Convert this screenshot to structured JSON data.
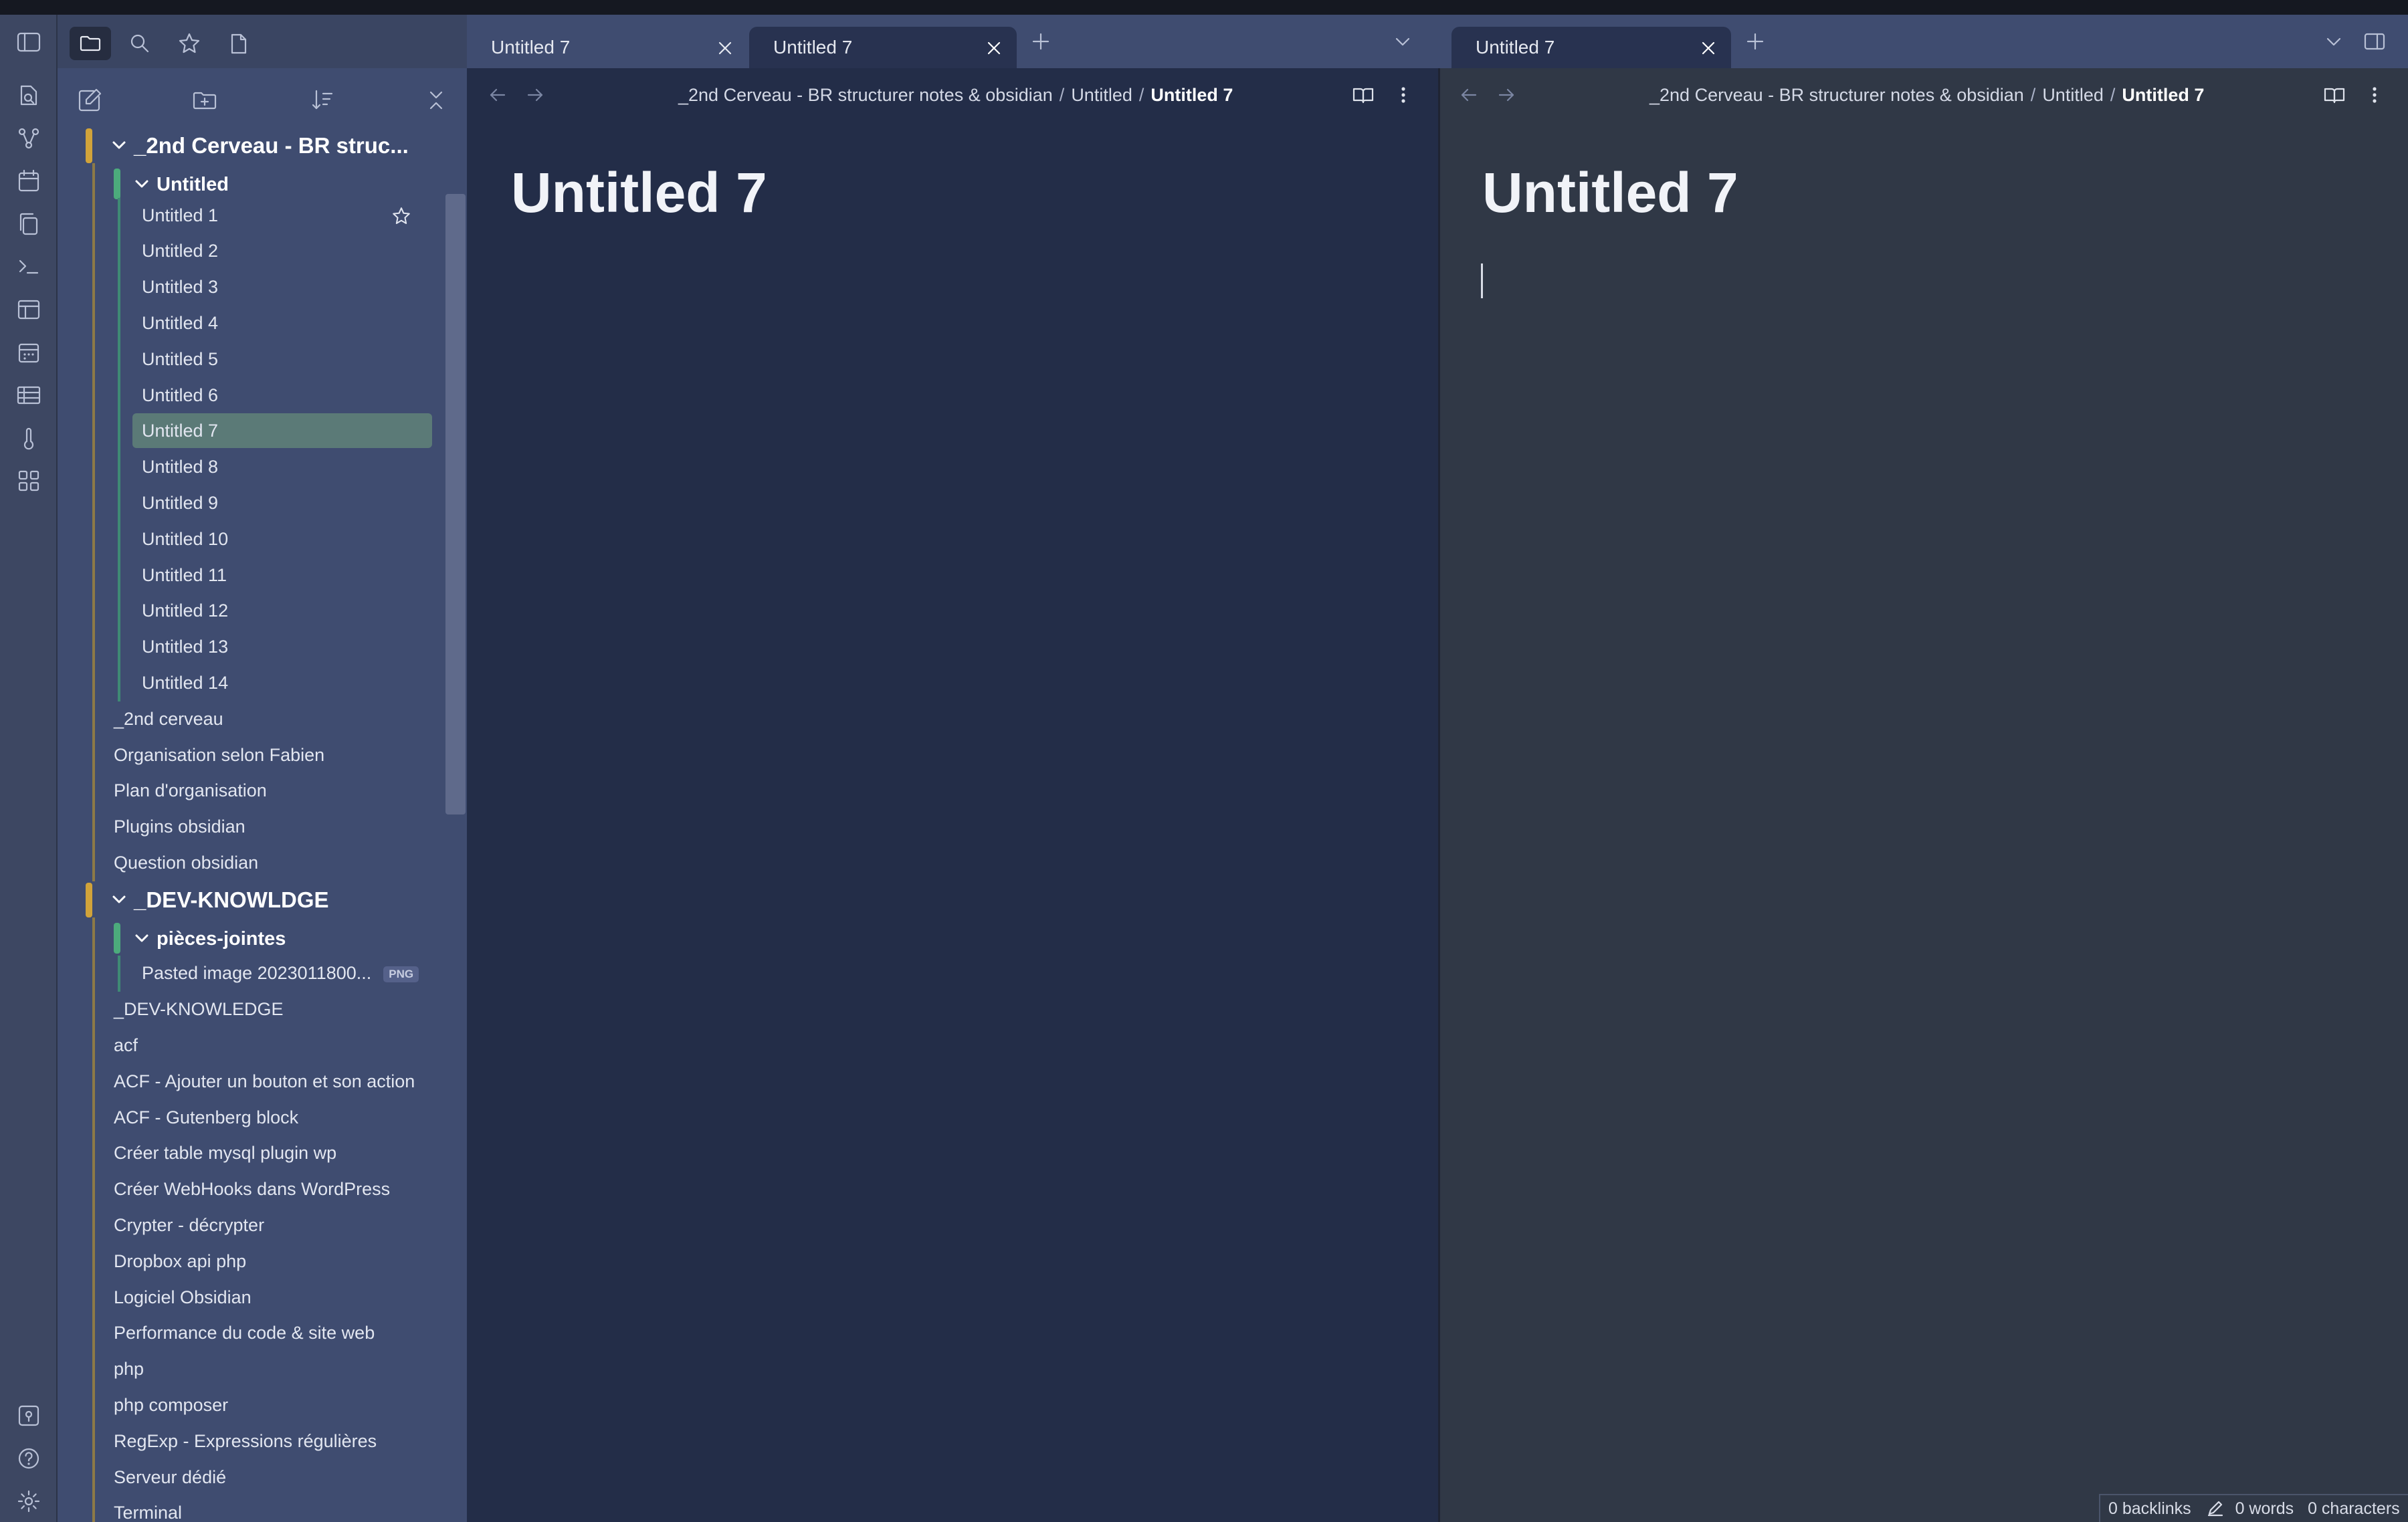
{
  "ribbon": {
    "icons": [
      "sidebar-toggle-icon",
      "file-search-icon",
      "graph-icon",
      "calendar-icon",
      "copy-icon",
      "terminal-icon",
      "layout-icon",
      "calendar-grid-icon",
      "table-icon",
      "thermometer-icon",
      "dashboard-icon",
      "vault-icon",
      "help-icon",
      "settings-icon"
    ]
  },
  "sidebar": {
    "tabs": [
      "folder-icon",
      "search-icon",
      "star-icon",
      "file-icon"
    ],
    "actions": [
      "new-note-icon",
      "new-folder-icon",
      "sort-icon",
      "collapse-icon"
    ],
    "tree": {
      "root1": "_2nd Cerveau - BR struc...",
      "sub1": "Untitled",
      "sub1_items": [
        "Untitled 1",
        "Untitled 2",
        "Untitled 3",
        "Untitled 4",
        "Untitled 5",
        "Untitled 6",
        "Untitled 7",
        "Untitled 8",
        "Untitled 9",
        "Untitled 10",
        "Untitled 11",
        "Untitled 12",
        "Untitled 13",
        "Untitled 14"
      ],
      "root1_items": [
        "_2nd cerveau",
        "Organisation selon Fabien",
        "Plan d'organisation",
        "Plugins obsidian",
        "Question obsidian"
      ],
      "root2": "_DEV-KNOWLDGE",
      "sub2": "pièces-jointes",
      "sub2_item": "Pasted image 2023011800...",
      "sub2_badge": "PNG",
      "root2_items": [
        "_DEV-KNOWLEDGE",
        "acf",
        "ACF - Ajouter un bouton et son action",
        "ACF - Gutenberg block",
        "Créer table mysql plugin wp",
        "Créer WebHooks dans WordPress",
        "Crypter - décrypter",
        "Dropbox api php",
        "Logiciel Obsidian",
        "Performance du code & site web",
        "php",
        "php composer",
        "RegExp - Expressions régulières",
        "Serveur dédié",
        "Terminal"
      ],
      "selected": "Untitled 7"
    }
  },
  "left_pane": {
    "tabs": [
      {
        "label": "Untitled 7",
        "active": false
      },
      {
        "label": "Untitled 7",
        "active": true
      }
    ],
    "breadcrumb": [
      "_2nd Cerveau - BR structurer notes & obsidian",
      "Untitled",
      "Untitled 7"
    ],
    "title": "Untitled 7"
  },
  "right_pane": {
    "tabs": [
      {
        "label": "Untitled 7",
        "active": true
      }
    ],
    "breadcrumb": [
      "_2nd Cerveau - BR structurer notes & obsidian",
      "Untitled",
      "Untitled 7"
    ],
    "title": "Untitled 7"
  },
  "status": {
    "backlinks": "0 backlinks",
    "words": "0 words",
    "characters": "0 characters"
  },
  "colors": {
    "sidebar_bg": "#3f4c70",
    "editor_bg_left": "#232d48",
    "editor_bg_right": "#303846",
    "accent_yellow": "#d1a33a",
    "accent_green": "#4cab7c",
    "selected_row": "#5b7a77"
  }
}
